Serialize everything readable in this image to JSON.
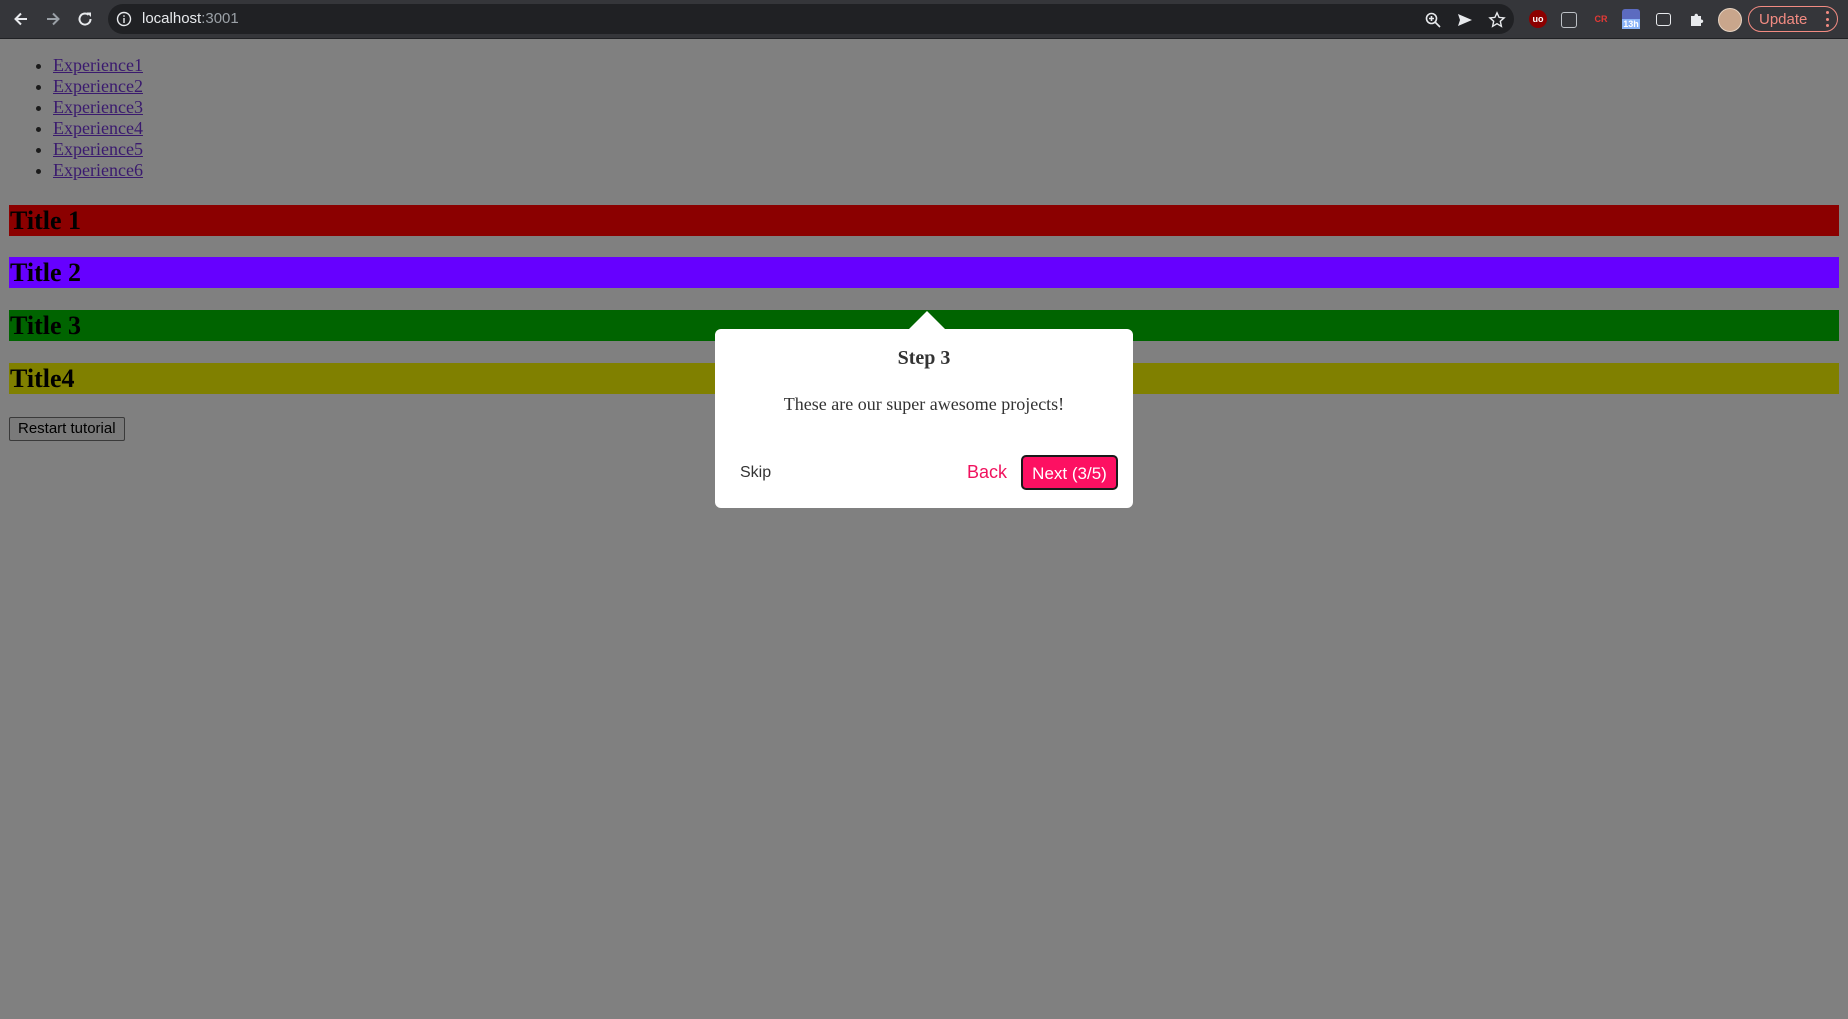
{
  "browser": {
    "url_host": "localhost",
    "url_port": ":3001",
    "update_label": "Update",
    "extension_badge": "13h"
  },
  "nav": {
    "items": [
      {
        "label": "Experience1"
      },
      {
        "label": "Experience2"
      },
      {
        "label": "Experience3"
      },
      {
        "label": "Experience4"
      },
      {
        "label": "Experience5"
      },
      {
        "label": "Experience6"
      }
    ]
  },
  "sections": [
    {
      "title": "Title 1",
      "color": "#8b0000"
    },
    {
      "title": "Title 2",
      "color": "#6600ff"
    },
    {
      "title": "Title 3",
      "color": "#006400"
    },
    {
      "title": "Title4",
      "color": "#808000"
    }
  ],
  "restart_label": "Restart tutorial",
  "tour": {
    "title": "Step 3",
    "body": "These are our super awesome projects!",
    "skip_label": "Skip",
    "back_label": "Back",
    "next_label": "Next (3/5)",
    "accent_color": "#fd1062"
  }
}
